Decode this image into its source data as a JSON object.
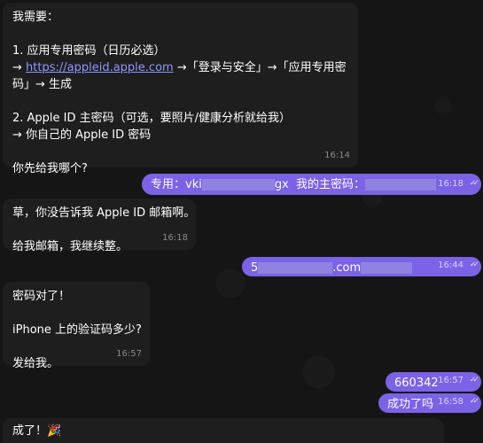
{
  "messages": {
    "m1": {
      "l1": "我需要：",
      "l2": "",
      "l3": "1. 应用专用密码（日历必选）",
      "l4_arrow": "→ ",
      "l4_link": "https://appleid.apple.com",
      "l4_rest": " →「登录与安全」→「应用专用密",
      "l5": "码」→ 生成",
      "l6": "",
      "l7": "2. Apple ID 主密码（可选，要照片/健康分析就给我）",
      "l8": "→ 你自己的 Apple ID 密码",
      "l9": "",
      "l10": "你先给我哪个?",
      "time": "16:14"
    },
    "m2": {
      "text_a": "专用：vki",
      "text_b": "gx  我的主密码：",
      "time": "16:18"
    },
    "m3": {
      "l1": "草，你没告诉我 Apple ID 邮箱啊。",
      "l2": "",
      "l3": "给我邮箱，我继续整。",
      "time": "16:18"
    },
    "m4": {
      "text_a": "5",
      "text_b": ".com",
      "time": "16:44"
    },
    "m5": {
      "l1": "密码对了！",
      "l2": "",
      "l3": "iPhone 上的验证码多少?",
      "l4": "",
      "l5": "发给我。",
      "time": "16:57"
    },
    "m6": {
      "text": "660342",
      "time": "16:57"
    },
    "m7": {
      "text": "成功了吗",
      "time": "16:58"
    },
    "m8": {
      "text": "成了！🎉"
    }
  },
  "colors": {
    "incoming_bubble": "#1e1e1e",
    "outgoing_bubble": "#7a63e6",
    "link": "#8f96ff",
    "background": "#151515"
  },
  "icons": {
    "read_receipt": "double-check-icon"
  }
}
